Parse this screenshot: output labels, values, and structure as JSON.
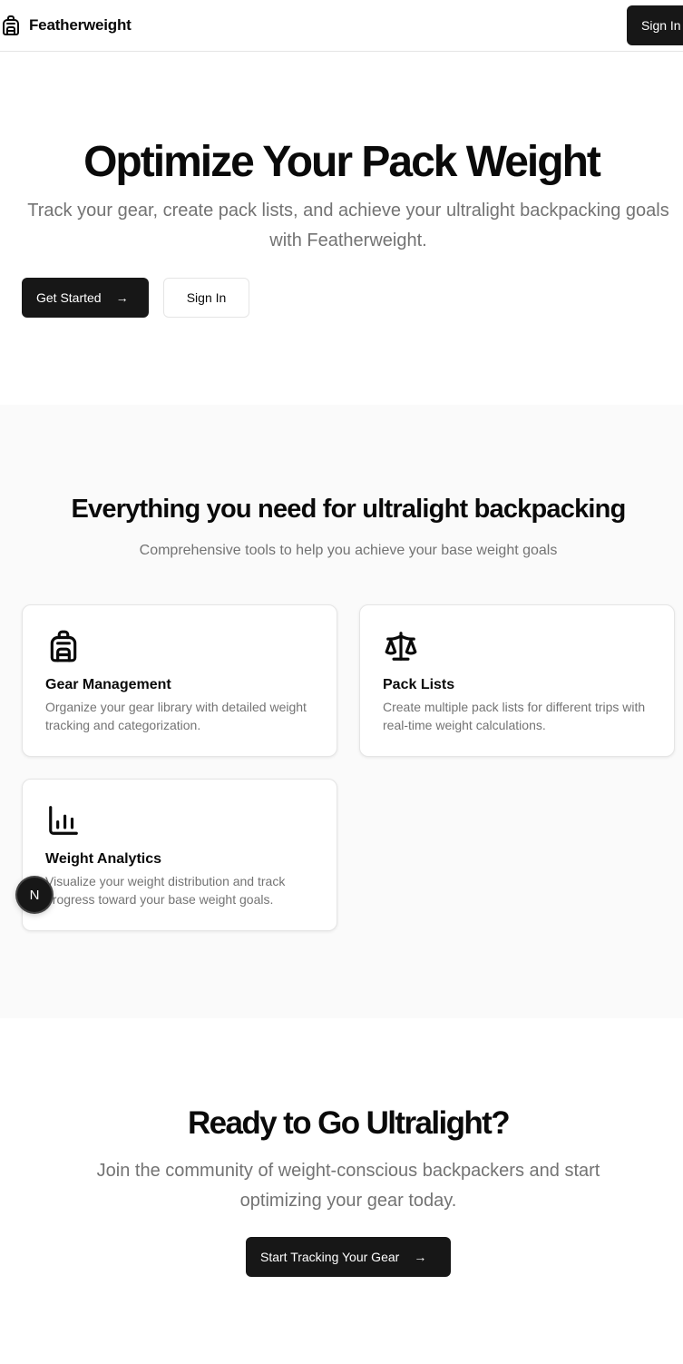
{
  "header": {
    "brand": "Featherweight",
    "sign_in": "Sign In"
  },
  "hero": {
    "title": "Optimize Your Pack Weight",
    "subtitle": "Track your gear, create pack lists, and achieve your ultralight backpacking goals with Featherweight.",
    "primary_button": "Get Started",
    "secondary_button": "Sign In"
  },
  "features": {
    "title": "Everything you need for ultralight backpacking",
    "subtitle": "Comprehensive tools to help you achieve your base weight goals",
    "cards": [
      {
        "icon": "backpack-icon",
        "title": "Gear Management",
        "description": "Organize your gear library with detailed weight tracking and categorization."
      },
      {
        "icon": "scale-icon",
        "title": "Pack Lists",
        "description": "Create multiple pack lists for different trips with real-time weight calculations."
      },
      {
        "icon": "bar-chart-icon",
        "title": "Weight Analytics",
        "description": "Visualize your weight distribution and track progress toward your base weight goals."
      }
    ]
  },
  "badge": {
    "letter": "N"
  },
  "cta": {
    "title": "Ready to Go Ultralight?",
    "subtitle": "Join the community of weight-conscious backpackers and start optimizing your gear today.",
    "button": "Start Tracking Your Gear"
  },
  "colors": {
    "primary": "#171717",
    "muted_text": "#737373",
    "border": "#e5e5e5",
    "section_bg": "#fafafa"
  }
}
